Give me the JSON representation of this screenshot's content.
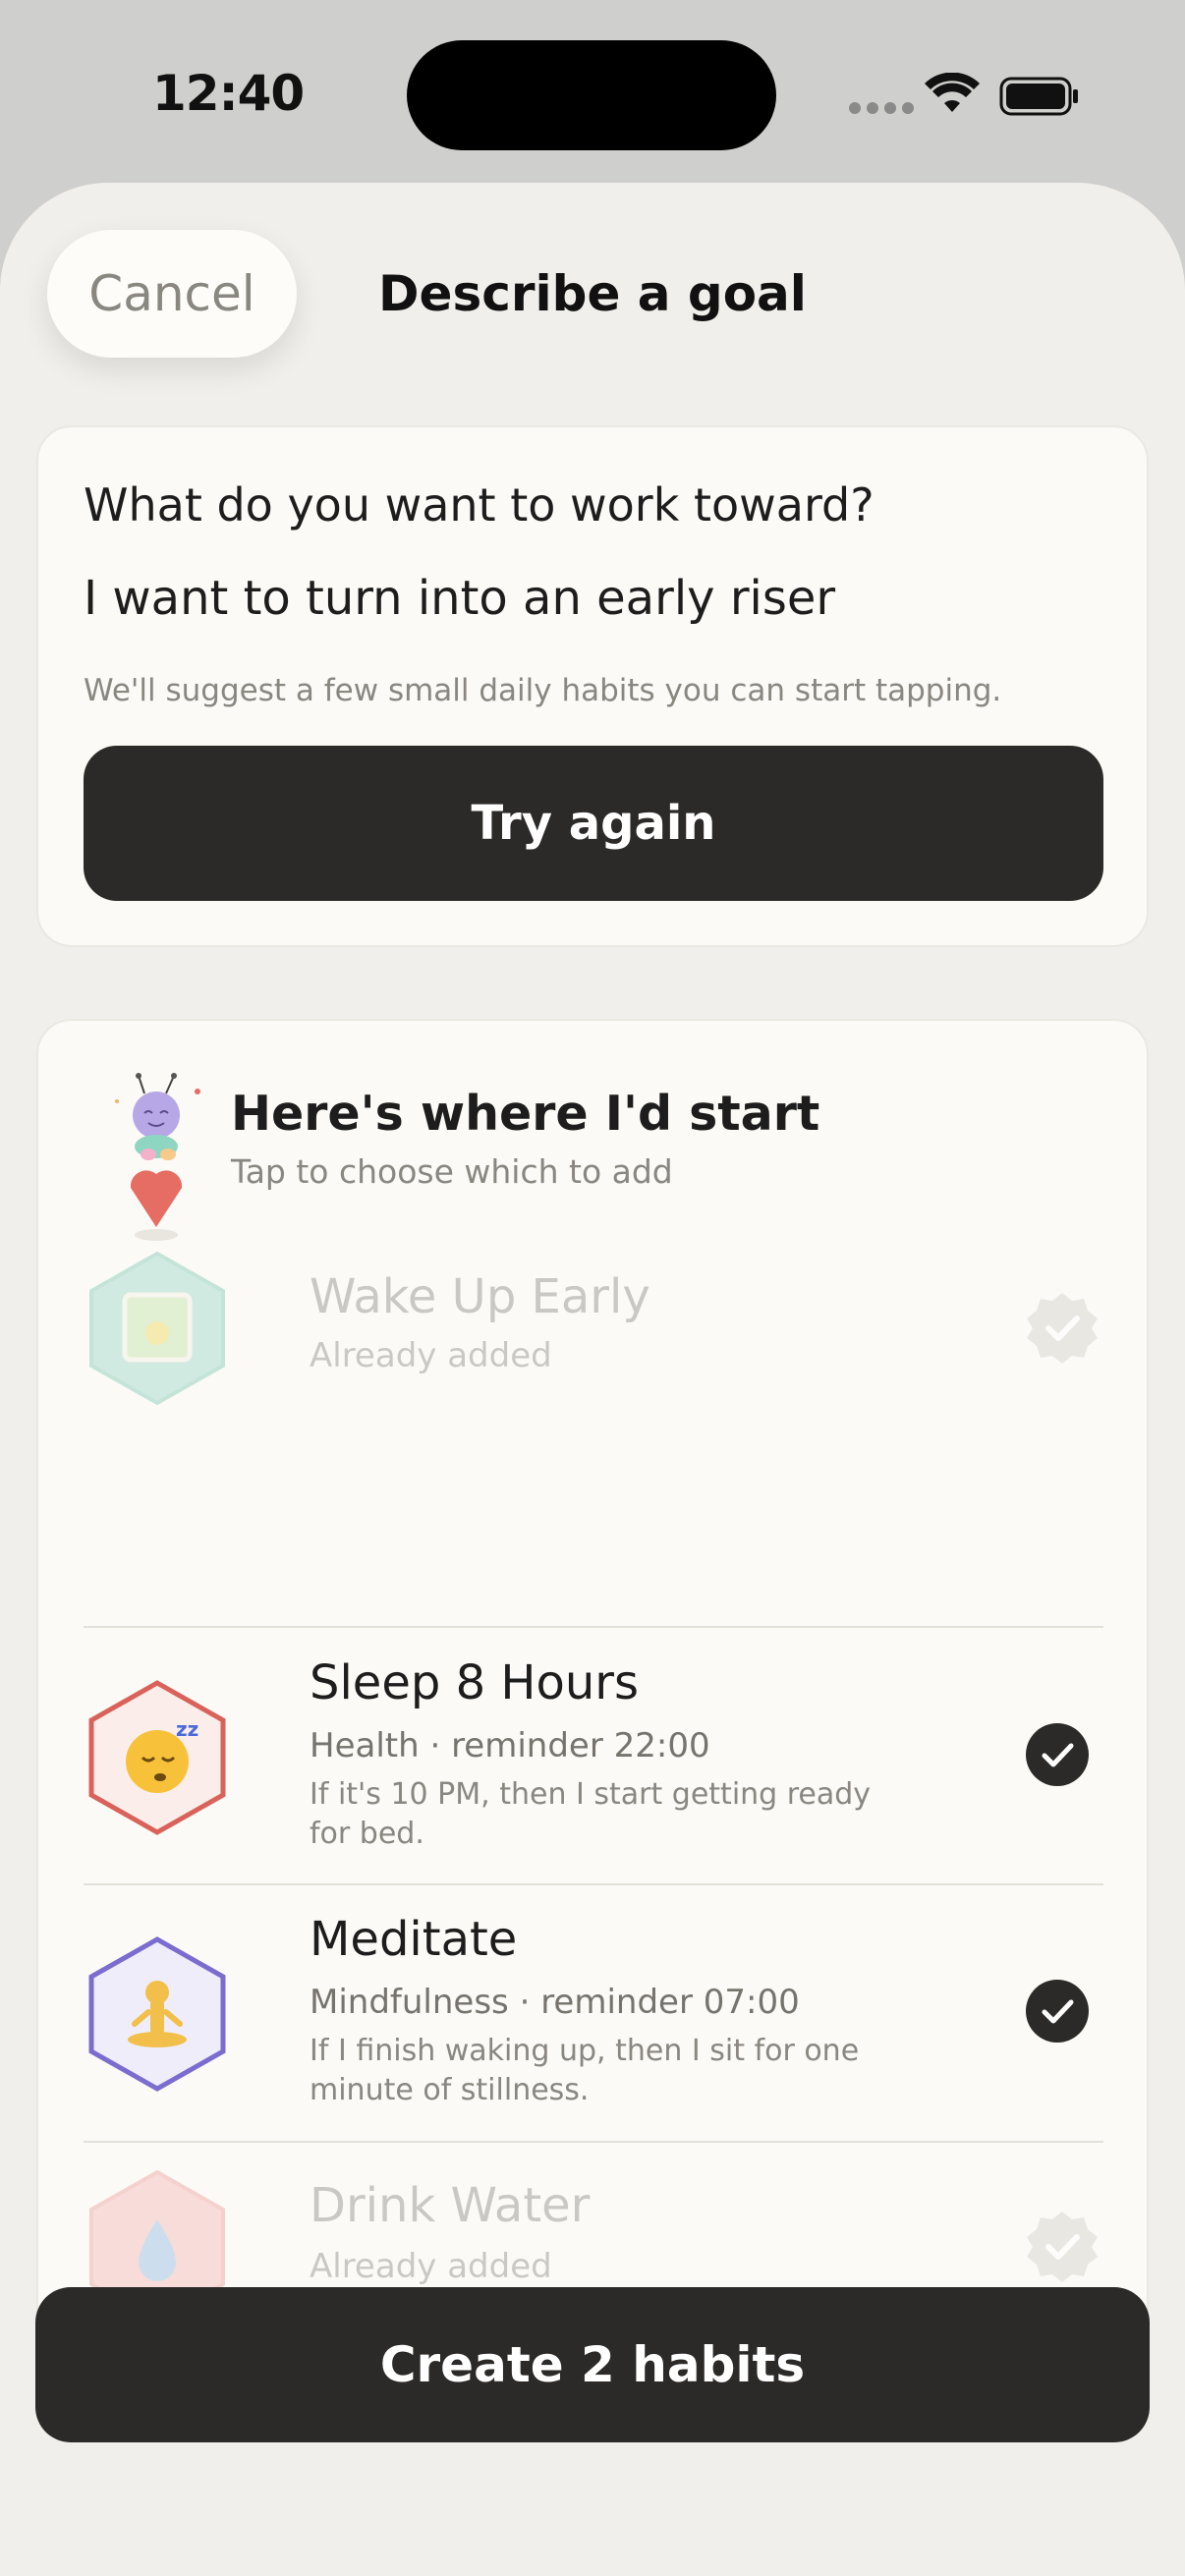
{
  "status": {
    "time": "12:40"
  },
  "header": {
    "cancel_label": "Cancel",
    "title": "Describe a goal"
  },
  "goal": {
    "question": "What do you want to work toward?",
    "value": "I want to turn into an early riser",
    "hint": "We'll suggest a few small daily habits you can start tapping.",
    "try_again_label": "Try again"
  },
  "suggestions": {
    "title": "Here's where I'd start",
    "subtitle": "Tap to choose which to add",
    "items": [
      {
        "name": "Wake Up Early",
        "meta": "Already added",
        "description": "",
        "state": "already-added",
        "icon": "sunrise-icon",
        "color": "#9fd8c8"
      },
      {
        "name": "Sleep 8 Hours",
        "meta": "Health · reminder 22:00",
        "description": "If it's 10 PM, then I start getting ready for bed.",
        "state": "selected",
        "icon": "sleeping-face-icon",
        "color": "#d9534f"
      },
      {
        "name": "Meditate",
        "meta": "Mindfulness · reminder 07:00",
        "description": "If I finish waking up, then I sit for one minute of stillness.",
        "state": "selected",
        "icon": "meditation-icon",
        "color": "#7b6ccf"
      },
      {
        "name": "Drink Water",
        "meta": "Already added",
        "description": "",
        "state": "already-added",
        "icon": "water-drop-icon",
        "color": "#f0a8a8"
      }
    ]
  },
  "footer": {
    "create_label": "Create 2 habits"
  },
  "colors": {
    "accent_dark": "#2c2a29",
    "sheet_bg": "#f1efeb",
    "card_bg": "#fbfaf6"
  }
}
